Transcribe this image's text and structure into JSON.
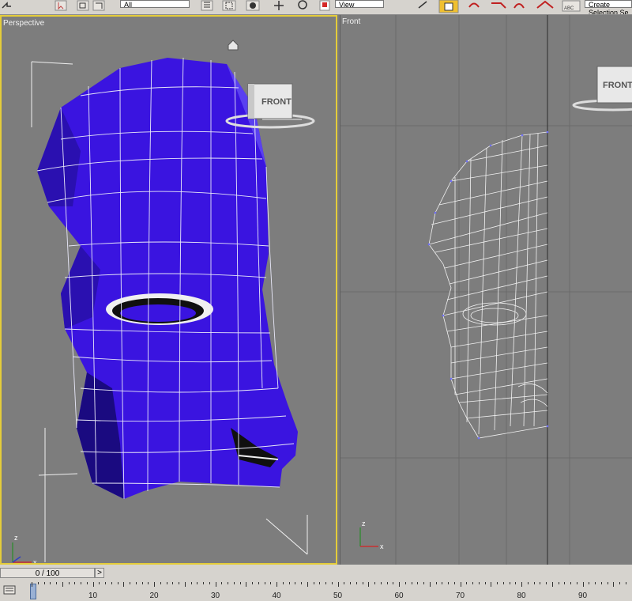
{
  "toolbar": {
    "dropdown_left": "All",
    "dropdown_middle": "View",
    "dropdown_right": "Create Selection Se",
    "button_icons": [
      "undo-icon",
      "select-icon",
      "select-by-name-icon",
      "rect-select-icon",
      "window-crossing-icon",
      "move-icon",
      "rotate-icon",
      "scale-icon",
      "snap-icon",
      "angle-snap-icon",
      "percent-snap-icon",
      "spinner-snap-icon",
      "edit-named-selection-icon",
      "mirror-icon",
      "align-icon",
      "curve-editor-icon",
      "material-editor-icon"
    ]
  },
  "viewports": {
    "perspective": {
      "label": "Perspective",
      "viewcube_text": "FRONT",
      "active": true
    },
    "front": {
      "label": "Front",
      "viewcube_text": "FRONT",
      "active": false
    }
  },
  "time_slider": {
    "label": "0 / 100",
    "next": ">"
  },
  "trackbar": {
    "current_frame": 0,
    "ticks": [
      "0",
      "10",
      "20",
      "30",
      "40",
      "50",
      "60",
      "70",
      "80",
      "90"
    ]
  },
  "colors": {
    "mesh": "#3a14e0",
    "wire": "#f5f5f5",
    "active_border": "#e4cc3a",
    "background": "#7d7d7d"
  }
}
